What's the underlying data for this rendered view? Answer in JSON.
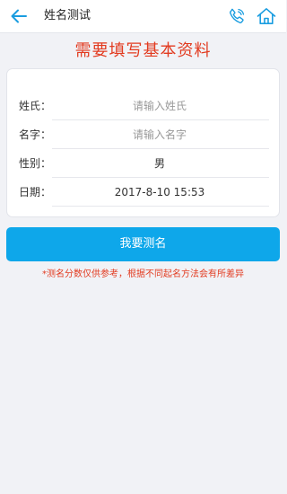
{
  "topbar": {
    "title": "姓名测试",
    "back_icon": "arrow-left-icon",
    "phone_icon": "phone-icon",
    "home_icon": "home-icon",
    "accent_color": "#0ea7ea"
  },
  "headline": "需要填写基本资料",
  "form": {
    "surname": {
      "label": "姓氏：",
      "placeholder": "请输入姓氏",
      "value": ""
    },
    "given_name": {
      "label": "名字：",
      "placeholder": "请输入名字",
      "value": ""
    },
    "gender": {
      "label": "性别：",
      "value": "男"
    },
    "date": {
      "label": "日期：",
      "value": "2017-8-10 15:53"
    }
  },
  "submit": {
    "label": "我要测名"
  },
  "disclaimer": "*测名分数仅供参考，根据不同起名方法会有所差异",
  "colors": {
    "headline": "#e23b20",
    "button": "#0ea7ea",
    "background": "#f1f2f6"
  }
}
